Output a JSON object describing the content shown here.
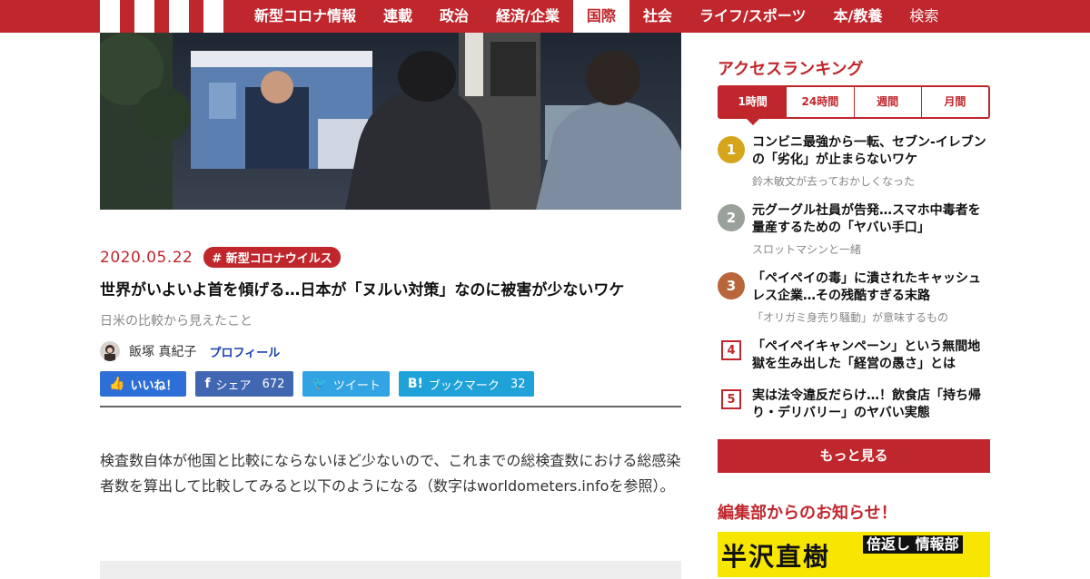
{
  "header": {
    "nav": [
      {
        "label": "新型コロナ情報"
      },
      {
        "label": "連載"
      },
      {
        "label": "政治"
      },
      {
        "label": "経済/企業"
      },
      {
        "label": "国際"
      },
      {
        "label": "社会"
      },
      {
        "label": "ライフ/スポーツ"
      },
      {
        "label": "本/教養"
      },
      {
        "label": "検索"
      }
    ],
    "active": "国際"
  },
  "article": {
    "date": "2020.05.22",
    "tag": "# 新型コロナウイルス",
    "title": "世界がいよいよ首を傾げる…日本が「ヌルい対策」なのに被害が少ないワケ",
    "subtitle": "日米の比較から見えたこと",
    "author": "飯塚 真紀子",
    "profile_link": "プロフィール",
    "share": {
      "like": "いいね！",
      "facebook": "シェア",
      "facebook_count": "672",
      "twitter": "ツイート",
      "hatena": "ブックマーク",
      "hatena_count": "32"
    },
    "body": "検査数自体が他国と比較にならないほど少ないので、これまでの総検査数における総感染者数を算出して比較してみると以下のようになる（数字はworldometers.infoを参照）。"
  },
  "sidebar": {
    "ranking_heading": "アクセスランキング",
    "tabs": [
      {
        "label": "1時間"
      },
      {
        "label": "24時間"
      },
      {
        "label": "週間"
      },
      {
        "label": "月間"
      }
    ],
    "active_tab": "1時間",
    "ranking": [
      {
        "rank": "1",
        "title": "コンビニ最強から一転、セブン-イレブンの「劣化」が止まらないワケ",
        "sub": "鈴木敏文が去っておかしくなった",
        "color": "#d6a51c"
      },
      {
        "rank": "2",
        "title": "元グーグル社員が告発…スマホ中毒者を量産するための「ヤバい手口」",
        "sub": "スロットマシンと一緒",
        "color": "#9aa09a"
      },
      {
        "rank": "3",
        "title": "「ペイペイの毒」に潰されたキャッシュレス企業…その残酷すぎる末路",
        "sub": "「オリガミ身売り騒動」が意味するもの",
        "color": "#b8663a"
      },
      {
        "rank": "4",
        "title": "「ペイペイキャンペーン」という無間地獄を生み出した「経営の愚さ」とは",
        "sub": ""
      },
      {
        "rank": "5",
        "title": "実は法令違反だらけ…！飲食店「持ち帰り・デリバリー」のヤバい実態",
        "sub": ""
      }
    ],
    "more": "もっと見る",
    "notice_heading": "編集部からのお知らせ！",
    "banner_title": "半沢直樹",
    "banner_sub": "倍返し 情報部"
  },
  "colors": {
    "brand": "#c0272d",
    "like": "#2d6fd7",
    "facebook": "#4267b2",
    "twitter": "#32a3e3",
    "hatena": "#1fa2d8"
  }
}
